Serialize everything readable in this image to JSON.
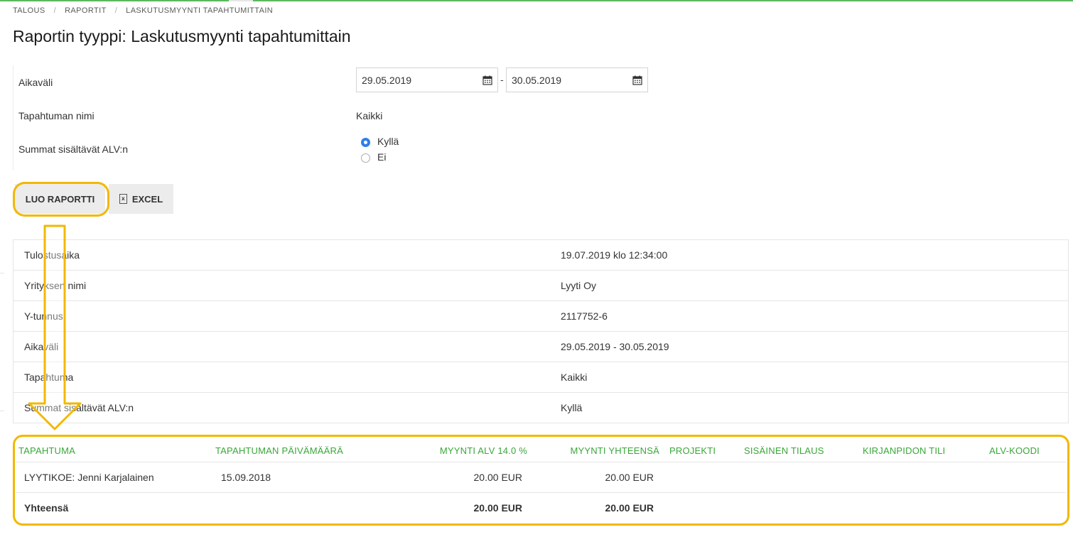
{
  "breadcrumb": [
    "TALOUS",
    "RAPORTIT",
    "LASKUTUSMYYNTI TAPAHTUMITTAIN"
  ],
  "page_title": "Raportin tyyppi: Laskutusmyynti tapahtumittain",
  "form": {
    "date_range_label": "Aikaväli",
    "date_from": "29.05.2019",
    "date_separator": "-",
    "date_to": "30.05.2019",
    "event_name_label": "Tapahtuman nimi",
    "event_name_value": "Kaikki",
    "vat_label": "Summat sisältävät ALV:n",
    "vat_options": [
      "Kyllä",
      "Ei"
    ],
    "vat_selected": "Kyllä"
  },
  "buttons": {
    "create_report": "LUO RAPORTTI",
    "excel": "EXCEL"
  },
  "info_rows": [
    {
      "label": "Tulostusaika",
      "value": "19.07.2019 klo 12:34:00"
    },
    {
      "label": "Yrityksen nimi",
      "value": "Lyyti Oy"
    },
    {
      "label": "Y-tunnus",
      "value": "2117752-6"
    },
    {
      "label": "Aikaväli",
      "value": "29.05.2019 - 30.05.2019"
    },
    {
      "label": "Tapahtuma",
      "value": "Kaikki"
    },
    {
      "label": "Summat sisältävät ALV:n",
      "value": "Kyllä"
    }
  ],
  "results": {
    "headers": [
      "TAPAHTUMA",
      "TAPAHTUMAN PÄIVÄMÄÄRÄ",
      "MYYNTI ALV 14.0 %",
      "MYYNTI YHTEENSÄ",
      "PROJEKTI",
      "SISÄINEN TILAUS",
      "KIRJANPIDON TILI",
      "ALV-KOODI"
    ],
    "rows": [
      [
        "LYYTIKOE: Jenni Karjalainen",
        "15.09.2018",
        "20.00 EUR",
        "20.00 EUR",
        "",
        "",
        "",
        ""
      ]
    ],
    "total": [
      "Yhteensä",
      "",
      "20.00 EUR",
      "20.00 EUR",
      "",
      "",
      "",
      ""
    ]
  },
  "colors": {
    "highlight": "#f2b800",
    "header_green": "#3aa63a",
    "radio_blue": "#2f7fe6"
  }
}
